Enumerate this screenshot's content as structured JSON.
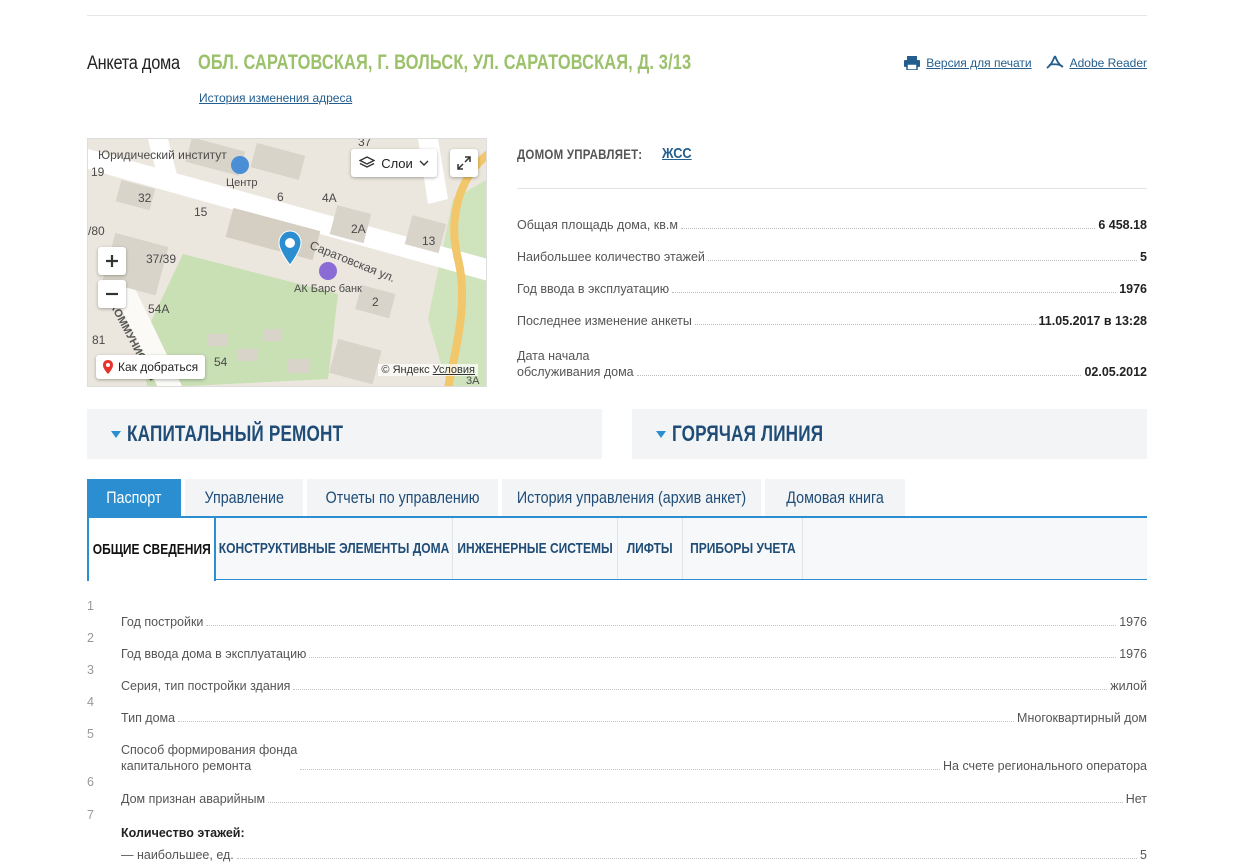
{
  "header": {
    "label": "Анкета дома",
    "address": "ОБЛ. САРАТОВСКАЯ, Г. ВОЛЬСК, УЛ. САРАТОВСКАЯ, Д. 3/13",
    "history_link": "История изменения адреса",
    "print_link": "Версия для печати",
    "reader_link": "Adobe Reader"
  },
  "map": {
    "layers_label": "Слои",
    "route_label": "Как добраться",
    "copyright": "© Яндекс",
    "terms": "Условия",
    "labels": {
      "institute": "Юридический институт",
      "center": "Центр",
      "bank": "АК Барс банк",
      "street": "Саратовская ул.",
      "street2": "КОММУНИСТИЧ",
      "n19": "19",
      "n32": "32",
      "n15": "15",
      "n6": "6",
      "n4a": "4А",
      "n2a": "2А",
      "n13": "13",
      "n80": "/80",
      "n3739": "37/39",
      "n2": "2",
      "n54a": "54А",
      "n81": "81",
      "n54": "54",
      "n37": "37",
      "n3a": "3А"
    }
  },
  "managed": {
    "label": "ДОМОМ УПРАВЛЯЕТ:",
    "value": "ЖСС"
  },
  "info": [
    {
      "label": "Общая площадь дома, кв.м",
      "value": "6 458.18"
    },
    {
      "label": "Наибольшее количество этажей",
      "value": "5"
    },
    {
      "label": "Год ввода в эксплуатацию",
      "value": "1976"
    },
    {
      "label": "Последнее изменение анкеты",
      "value": "11.05.2017 в 13:28"
    },
    {
      "label": "Дата начала",
      "label2": "обслуживания дома",
      "value": "02.05.2012"
    }
  ],
  "sections": {
    "repair": "КАПИТАЛЬНЫЙ РЕМОНТ",
    "hotline": "ГОРЯЧАЯ ЛИНИЯ"
  },
  "tabs": [
    "Паспорт",
    "Управление",
    "Отчеты по управлению",
    "История управления (архив анкет)",
    "Домовая книга"
  ],
  "subtabs": [
    "ОБЩИЕ СВЕДЕНИЯ",
    "КОНСТРУКТИВНЫЕ ЭЛЕМЕНТЫ ДОМА",
    "ИНЖЕНЕРНЫЕ СИСТЕМЫ",
    "ЛИФТЫ",
    "ПРИБОРЫ УЧЕТА"
  ],
  "passport": [
    {
      "num": "1",
      "label": "Год постройки",
      "value": "1976"
    },
    {
      "num": "2",
      "label": "Год ввода дома в эксплуатацию",
      "value": "1976"
    },
    {
      "num": "3",
      "label": "Серия, тип постройки здания",
      "value": "жилой"
    },
    {
      "num": "4",
      "label": "Тип дома",
      "value": "Многоквартирный дом"
    },
    {
      "num": "5",
      "label": "Способ формирования фонда",
      "label2": "капитального ремонта",
      "value": "На счете регионального оператора"
    },
    {
      "num": "6",
      "label": "Дом признан аварийным",
      "value": "Нет"
    },
    {
      "num": "7",
      "label": "Количество этажей:",
      "value": ""
    },
    {
      "num": "",
      "label": "— наибольшее, ед.",
      "value": "5"
    }
  ],
  "colors": {
    "accent": "#2b8ed1",
    "address": "#9bc16a",
    "link": "#235e8e",
    "heading": "#204d77"
  }
}
